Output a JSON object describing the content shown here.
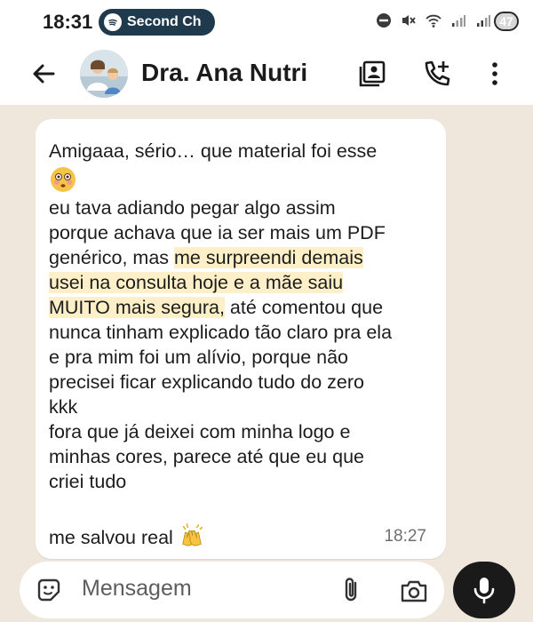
{
  "status_bar": {
    "time": "18:31",
    "media_app": "Second Ch",
    "battery": "47"
  },
  "header": {
    "contact_name": "Dra. Ana Nutri"
  },
  "message": {
    "lines": [
      "Amigaaa, sério… que material foi esse",
      "eu tava adiando pegar algo assim",
      "porque achava que ia ser mais um PDF",
      "genérico, mas ",
      "me surpreendi demais",
      "usei na consulta hoje e a mãe saiu",
      "MUITO mais segura,",
      " até comentou que",
      "nunca tinham explicado tão claro pra ela",
      "e pra mim foi um alívio, porque não",
      "precisei ficar explicando tudo do zero",
      "kkk",
      "fora que já deixei com minha logo e",
      "minhas cores, parece até que eu que",
      "criei tudo",
      "me salvou real"
    ],
    "time": "18:27"
  },
  "input": {
    "placeholder": "Mensagem"
  },
  "colors": {
    "highlight": "#fdefc7",
    "spotify_pill": "#1f3a4d",
    "background": "#efe7dc"
  }
}
